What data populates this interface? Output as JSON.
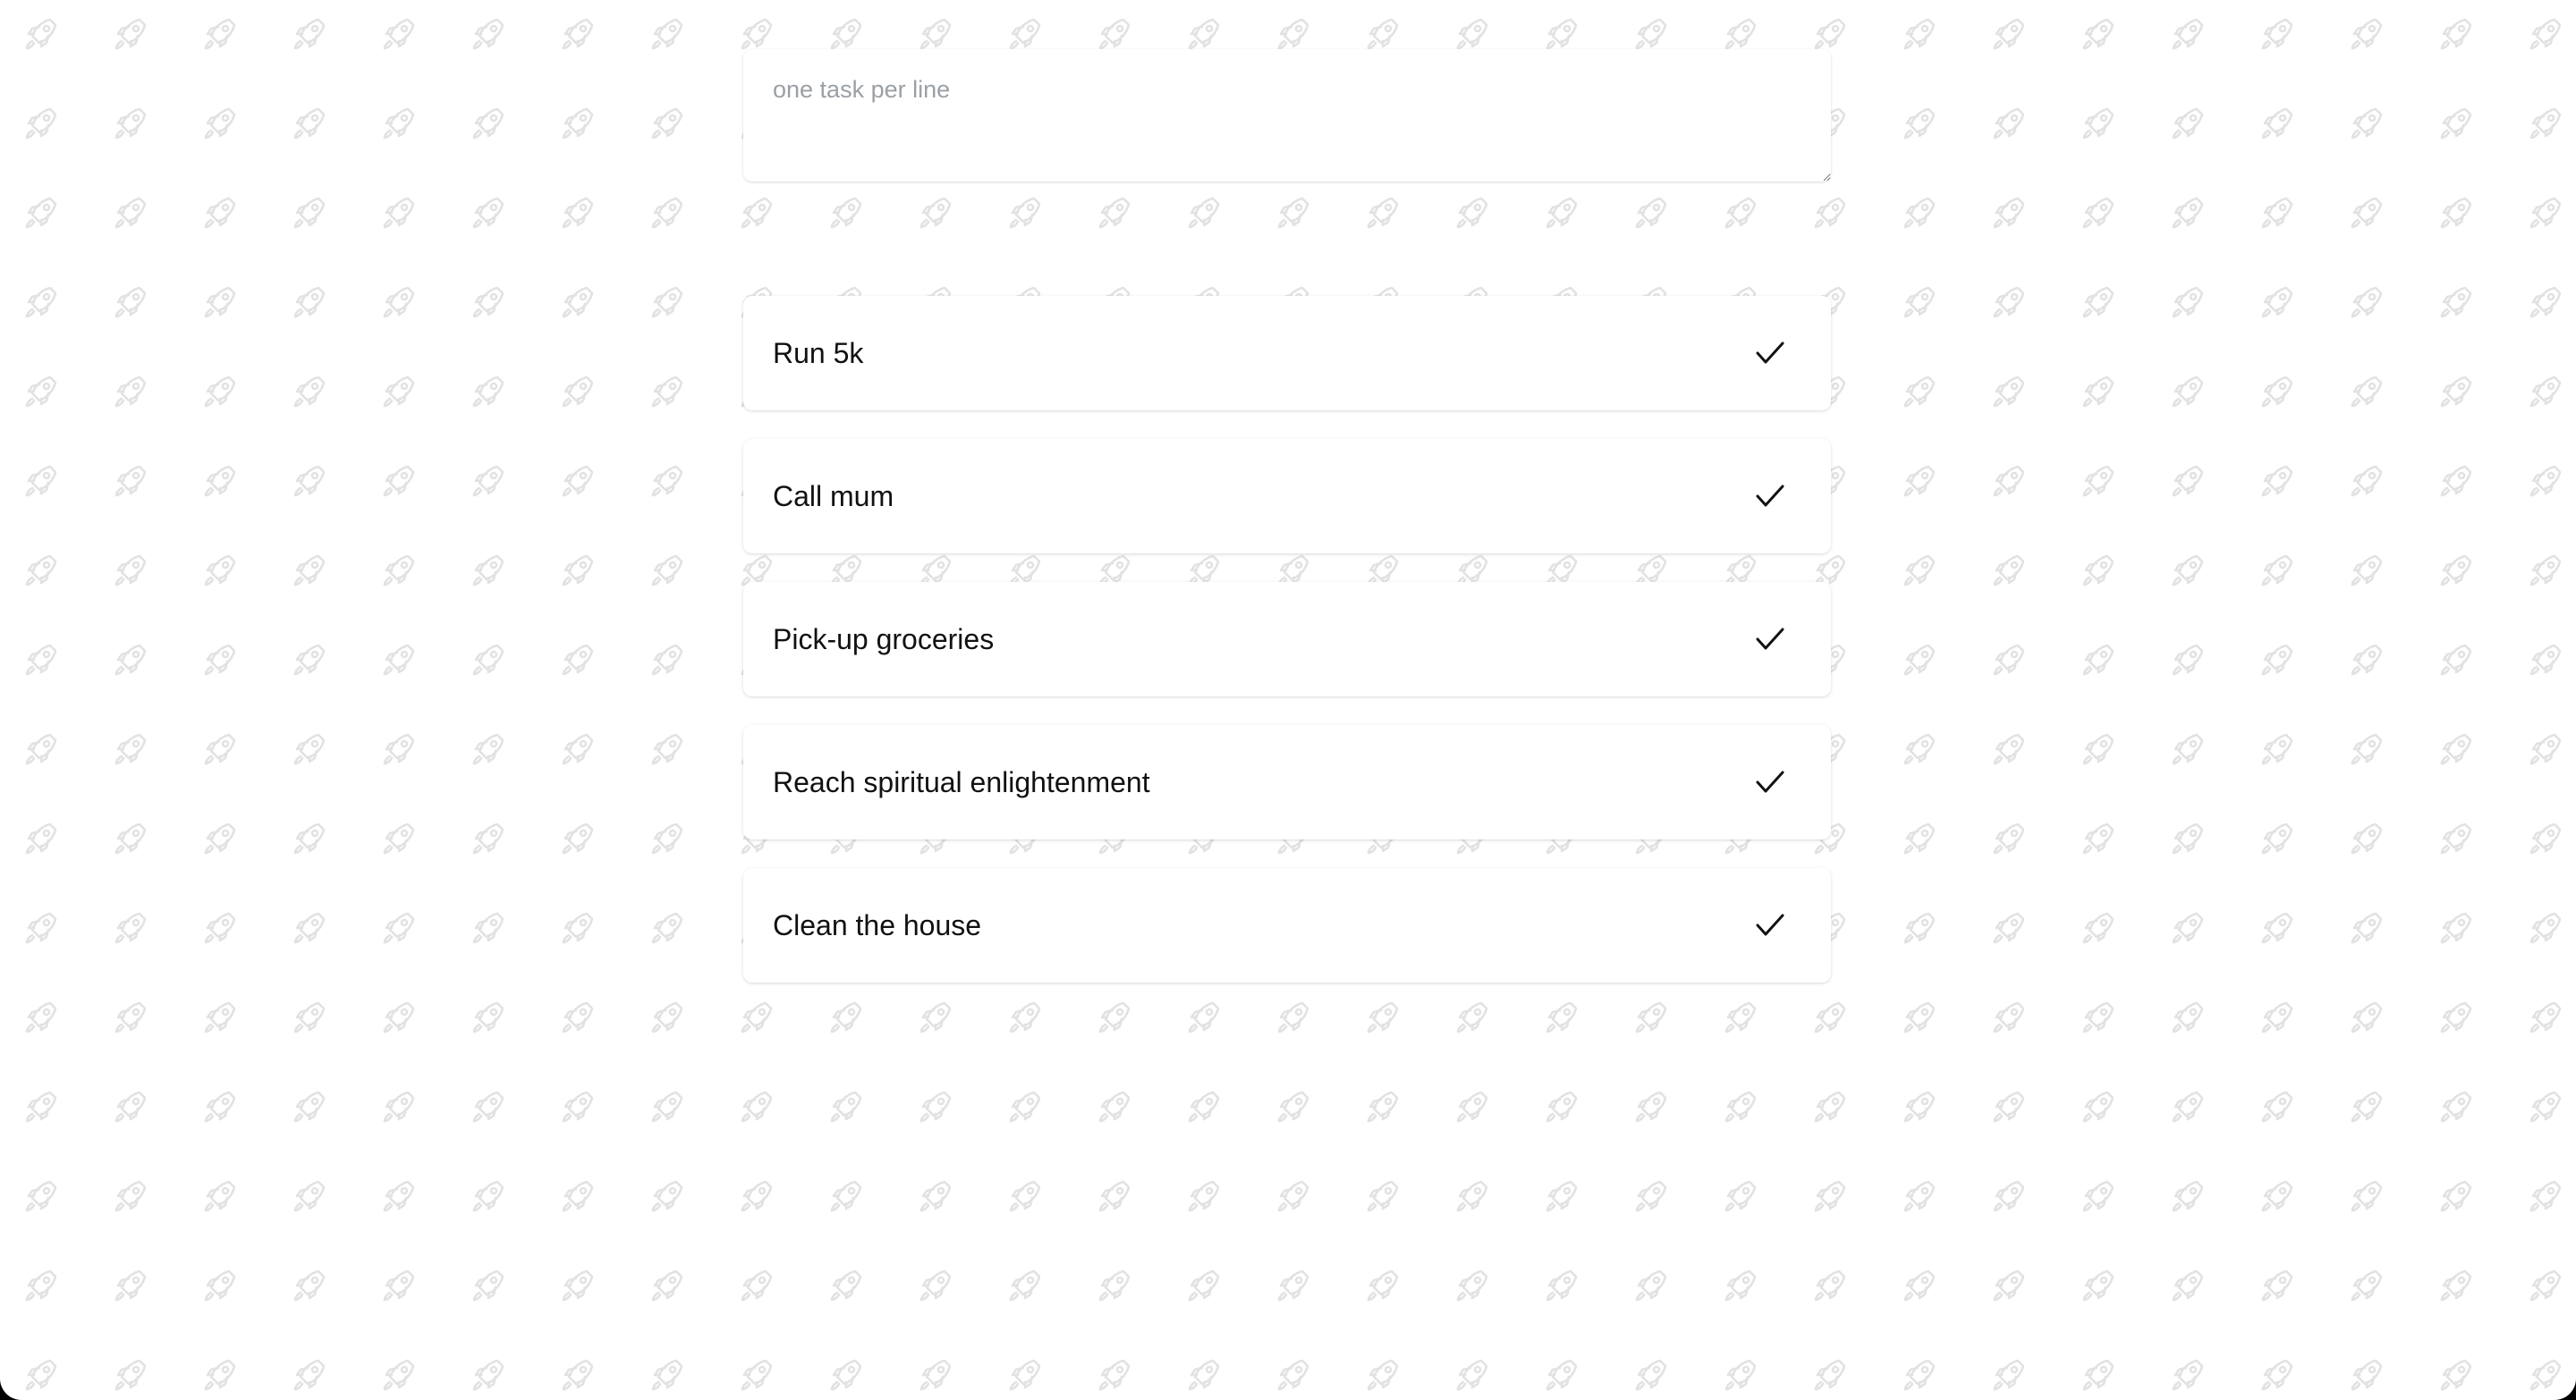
{
  "input": {
    "placeholder": "one task per line",
    "value": ""
  },
  "tasks": [
    {
      "label": "Run 5k",
      "icon": "check-icon"
    },
    {
      "label": "Call mum",
      "icon": "check-icon"
    },
    {
      "label": "Pick-up groceries",
      "icon": "check-icon"
    },
    {
      "label": "Reach spiritual enlightenment",
      "icon": "check-icon"
    },
    {
      "label": "Clean the house",
      "icon": "check-icon"
    }
  ],
  "background": {
    "pattern_icon": "rocket-icon",
    "pattern_color": "#e3e3e3",
    "background_color": "#ffffff"
  },
  "colors": {
    "text": "#111111",
    "placeholder": "#9aa0a6",
    "card": "#ffffff"
  }
}
